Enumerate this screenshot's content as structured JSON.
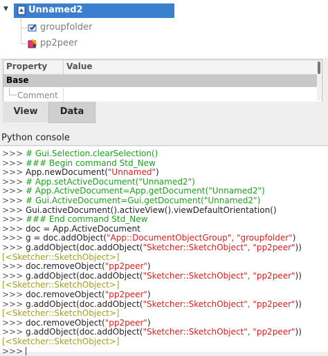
{
  "tree": {
    "expander": "▼",
    "document": "Unnamed2",
    "children": [
      "groupfolder",
      "pp2peer"
    ]
  },
  "properties": {
    "headers": [
      "Property",
      "Value"
    ],
    "group": "Base",
    "rows": [
      "Comment"
    ]
  },
  "tabs": [
    "View",
    "Data"
  ],
  "console": {
    "title": "Python console",
    "prompt": ">>> ",
    "lines": [
      [
        {
          "t": "# Gui.Selection.clearSelection()",
          "c": "com"
        }
      ],
      [
        {
          "t": "### Begin command Std_New",
          "c": "com"
        }
      ],
      [
        {
          "t": "App.newDocument(",
          "c": "def"
        },
        {
          "t": "\"Unnamed\"",
          "c": "str"
        },
        {
          "t": ")",
          "c": "def"
        }
      ],
      [
        {
          "t": "# App.setActiveDocument(\"Unnamed2\")",
          "c": "com"
        }
      ],
      [
        {
          "t": "# App.ActiveDocument=App.getDocument(\"Unnamed2\")",
          "c": "com"
        }
      ],
      [
        {
          "t": "# Gui.ActiveDocument=Gui.getDocument(\"Unnamed2\")",
          "c": "com"
        }
      ],
      [
        {
          "t": "Gui.activeDocument().activeView().viewDefaultOrientation()",
          "c": "def"
        }
      ],
      [
        {
          "t": "### End command Std_New",
          "c": "com"
        }
      ],
      [
        {
          "t": "doc = App.ActiveDocument",
          "c": "def"
        }
      ],
      [
        {
          "t": "g = doc.addObject(",
          "c": "def"
        },
        {
          "t": "\"App::DocumentObjectGroup\", \"groupfolder\"",
          "c": "str"
        },
        {
          "t": ")",
          "c": "def"
        }
      ],
      [
        {
          "t": "g.addObject(doc.addObject(",
          "c": "def"
        },
        {
          "t": "\"Sketcher::SketchObject\", \"pp2peer\"",
          "c": "str"
        },
        {
          "t": "))",
          "c": "def"
        }
      ],
      [
        {
          "t": "[<Sketcher::SketchObject>]",
          "c": "out",
          "np": true
        }
      ],
      [
        {
          "t": "doc.removeObject(",
          "c": "def"
        },
        {
          "t": "\"pp2peer\"",
          "c": "str"
        },
        {
          "t": ")",
          "c": "def"
        }
      ],
      [
        {
          "t": "g.addObject(doc.addObject(",
          "c": "def"
        },
        {
          "t": "\"Sketcher::SketchObject\", \"pp2peer\"",
          "c": "str"
        },
        {
          "t": "))",
          "c": "def"
        }
      ],
      [
        {
          "t": "[<Sketcher::SketchObject>]",
          "c": "out",
          "np": true
        }
      ],
      [
        {
          "t": "doc.removeObject(",
          "c": "def"
        },
        {
          "t": "\"pp2peer\"",
          "c": "str"
        },
        {
          "t": ")",
          "c": "def"
        }
      ],
      [
        {
          "t": "g.addObject(doc.addObject(",
          "c": "def"
        },
        {
          "t": "\"Sketcher::SketchObject\", \"pp2peer\"",
          "c": "str"
        },
        {
          "t": "))",
          "c": "def"
        }
      ],
      [
        {
          "t": "[<Sketcher::SketchObject>]",
          "c": "out",
          "np": true
        }
      ],
      [
        {
          "t": "doc.removeObject(",
          "c": "def"
        },
        {
          "t": "\"pp2peer\"",
          "c": "str"
        },
        {
          "t": ")",
          "c": "def"
        }
      ],
      [
        {
          "t": "g.addObject(doc.addObject(",
          "c": "def"
        },
        {
          "t": "\"Sketcher::SketchObject\", \"pp2peer\"",
          "c": "str"
        },
        {
          "t": "))",
          "c": "def"
        }
      ],
      [
        {
          "t": "[<Sketcher::SketchObject>]",
          "c": "out",
          "np": true
        }
      ],
      [
        {
          "t": "",
          "c": "def",
          "caret": true
        }
      ]
    ]
  },
  "colors": {
    "selection": "#3d7fcf",
    "comment": "#1aa31a",
    "string": "#e01b1b",
    "output": "#a0a020"
  }
}
